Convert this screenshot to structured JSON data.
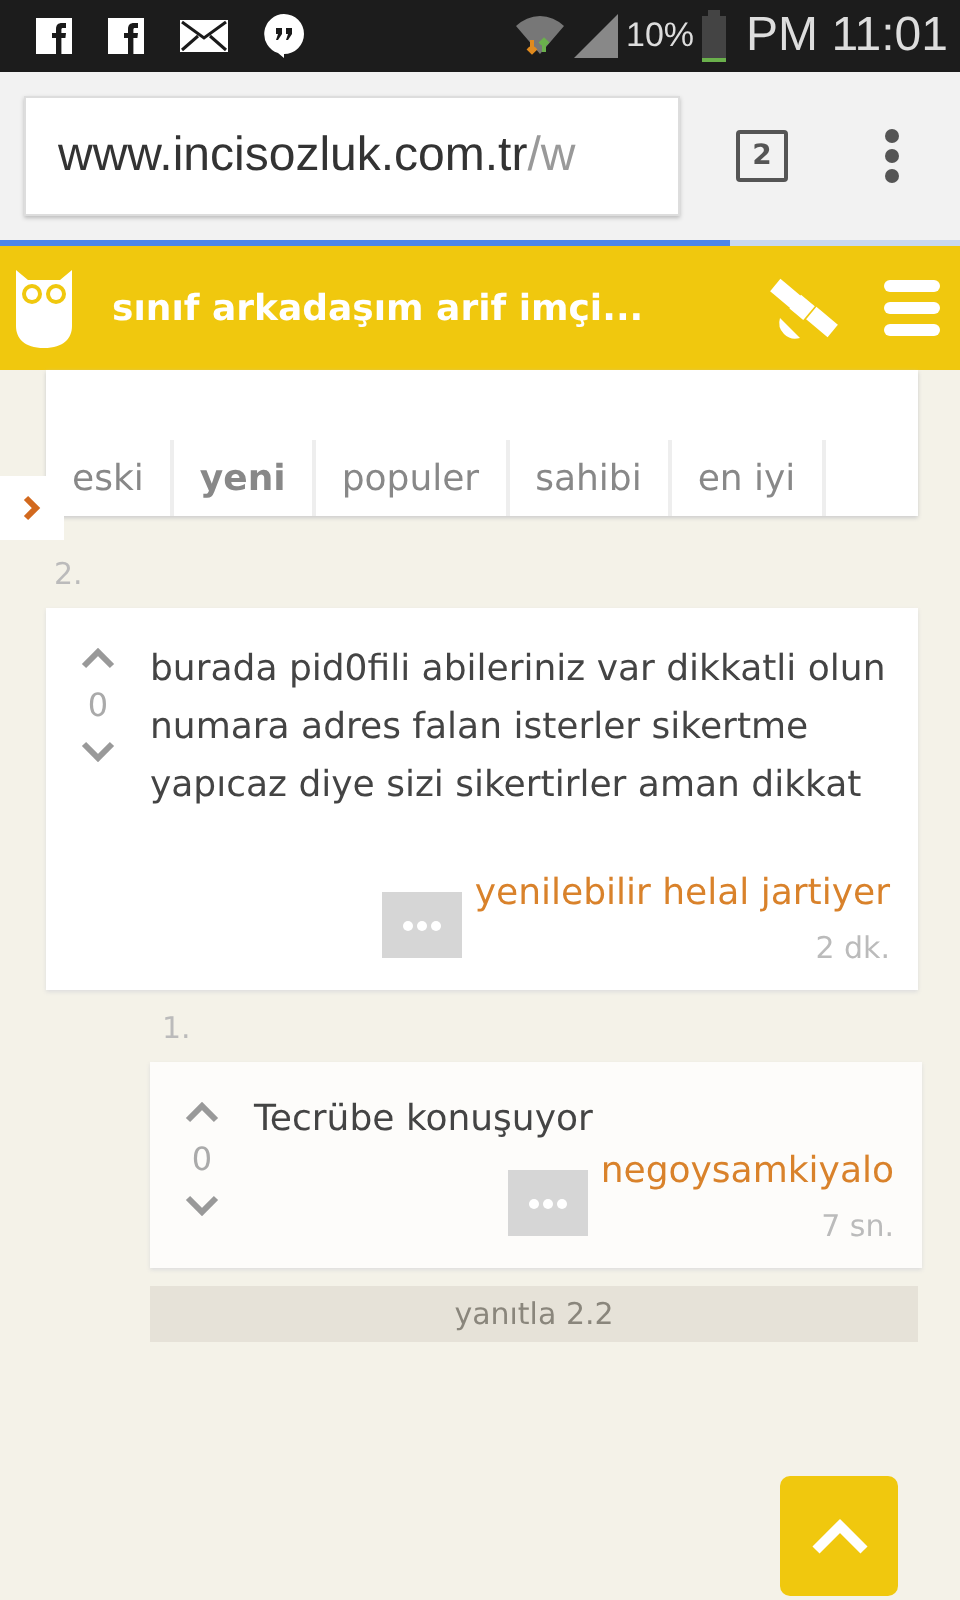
{
  "status_bar": {
    "battery": "10%",
    "time": "PM 11:01"
  },
  "browser": {
    "url_host": "www.incisozluk.com.tr",
    "url_path": "/w",
    "tab_count": "2",
    "progress": {
      "level": 0.76
    }
  },
  "header": {
    "title": "sınıf arkadaşım arif imçi..."
  },
  "tabs": [
    {
      "label": "eski",
      "selected": false
    },
    {
      "label": "yeni",
      "selected": true
    },
    {
      "label": "populer",
      "selected": false
    },
    {
      "label": "sahibi",
      "selected": false
    },
    {
      "label": "en iyi",
      "selected": false
    }
  ],
  "entry": {
    "number": "2.",
    "votes": "0",
    "text": "burada pid0fili abileriniz var dikkatli olun numara adres falan isterler sikertme yapıcaz diye sizi sikertirler aman dikkat",
    "author": "yenilebilir helal jartiyer",
    "time": "2 dk.",
    "replies": [
      {
        "number": "1.",
        "votes": "0",
        "text": "Tecrübe konuşuyor",
        "author": "negoysamkiyalo",
        "time": "7 sn."
      }
    ]
  },
  "reply_button": "yanıtla 2.2"
}
